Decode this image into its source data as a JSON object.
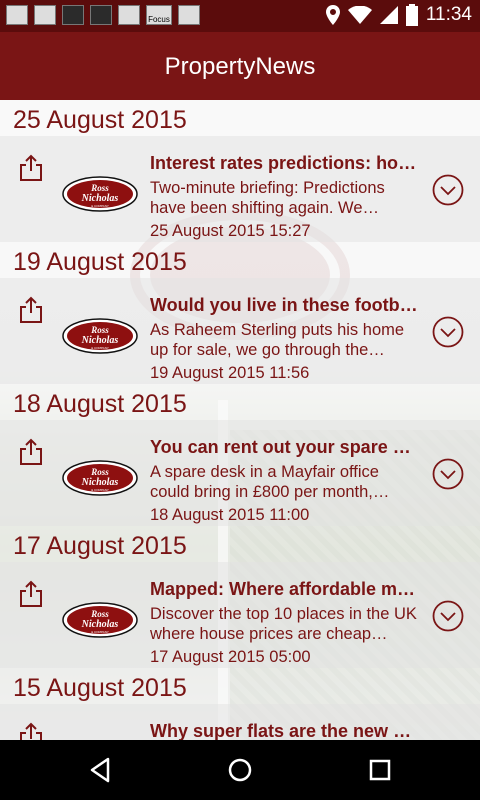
{
  "status_bar": {
    "time": "11:34",
    "notification_icons": [
      "gallery-icon",
      "app-icon",
      "app-icon",
      "app-icon",
      "download-icon",
      "focus-app-icon",
      "briefcase-icon"
    ],
    "focus_label": "Focus",
    "system_icons": [
      "location-icon",
      "wifi-icon",
      "signal-icon",
      "battery-icon"
    ]
  },
  "app": {
    "title": "PropertyNews"
  },
  "colors": {
    "brand": "#7a1515",
    "status_bar": "#5b0c0c"
  },
  "logo_text": {
    "line1": "Ross",
    "line2": "Nicholas",
    "line3": "& COMPANY"
  },
  "sections": [
    {
      "date": "25 August 2015",
      "item": {
        "title": "Interest rates predictions: how will they affect your mortgage?",
        "summary": "Two-minute briefing: Predictions have been shifting again. We…",
        "timestamp": "25 August 2015 15:27"
      }
    },
    {
      "date": "19 August 2015",
      "item": {
        "title": "Would you live in these football homes?",
        "summary": "As Raheem Sterling puts his home up for sale, we go through the…",
        "timestamp": "19 August 2015 11:56"
      }
    },
    {
      "date": "18 August 2015",
      "item": {
        "title": "You can rent out your spare office desk",
        "summary": "A spare desk in a Mayfair office could bring in £800 per month,…",
        "timestamp": "18 August 2015 11:00"
      }
    },
    {
      "date": "17 August 2015",
      "item": {
        "title": "Mapped: Where affordable mega homes are",
        "summary": "Discover the top 10 places in the UK where house prices are cheap…",
        "timestamp": "17 August 2015 05:00"
      }
    },
    {
      "date": "15 August 2015",
      "item": {
        "title": "Why super flats are the new mansions",
        "summary": "",
        "timestamp": ""
      }
    }
  ],
  "nav": {
    "icons": [
      "back-icon",
      "home-icon",
      "recents-icon"
    ]
  }
}
